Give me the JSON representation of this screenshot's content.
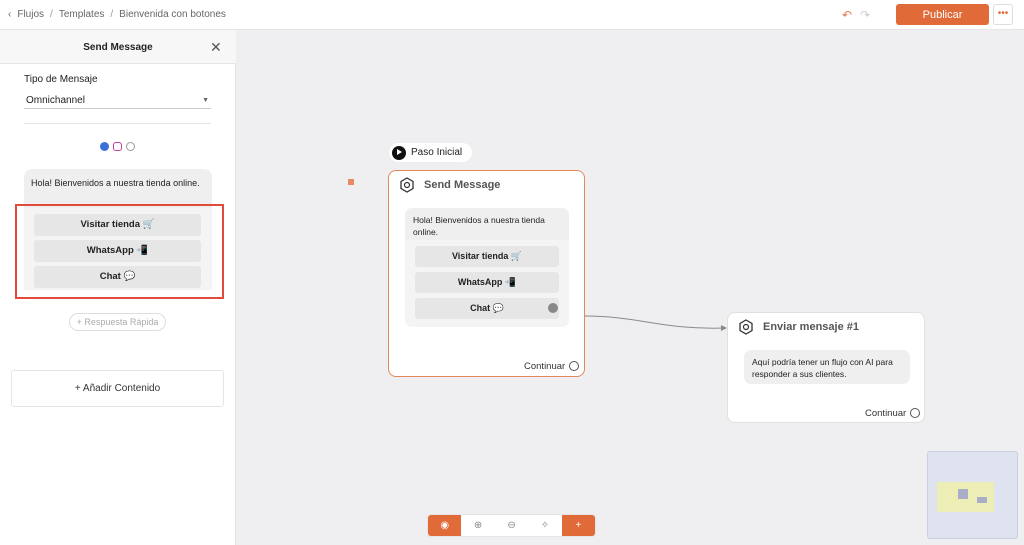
{
  "breadcrumb": {
    "items": [
      "Flujos",
      "Templates",
      "Bienvenida con botones"
    ]
  },
  "header": {
    "publish_label": "Publicar",
    "more_label": "•••"
  },
  "panel": {
    "title": "Send Message",
    "message_type_label": "Tipo de Mensaje",
    "message_type_value": "Omnichannel",
    "message_text": "Hola! Bienvenidos a nuestra tienda online.",
    "buttons": [
      {
        "label": "Visitar tienda 🛒"
      },
      {
        "label": "WhatsApp 📲"
      },
      {
        "label": "Chat 💬"
      }
    ],
    "quick_reply_label": "+ Respuesta Rápida",
    "add_content_label": "+ Añadir Contenido"
  },
  "canvas": {
    "start_label": "Paso Inicial",
    "node1": {
      "title": "Send Message",
      "message": "Hola! Bienvenidos a nuestra tienda online.",
      "buttons": [
        {
          "label": "Visitar tienda 🛒"
        },
        {
          "label": "WhatsApp 📲"
        },
        {
          "label": "Chat 💬"
        }
      ],
      "continue_label": "Continuar"
    },
    "node2": {
      "title": "Enviar mensaje #1",
      "message": "Aquí podría tener un flujo con AI para responder a sus clientes.",
      "continue_label": "Continuar"
    }
  },
  "toolbar": {
    "icons": [
      "eye-icon",
      "zoom-in-icon",
      "zoom-out-icon",
      "magic-icon",
      "plus-icon"
    ]
  },
  "colors": {
    "accent": "#e06a38",
    "highlight": "#e14b3b"
  }
}
